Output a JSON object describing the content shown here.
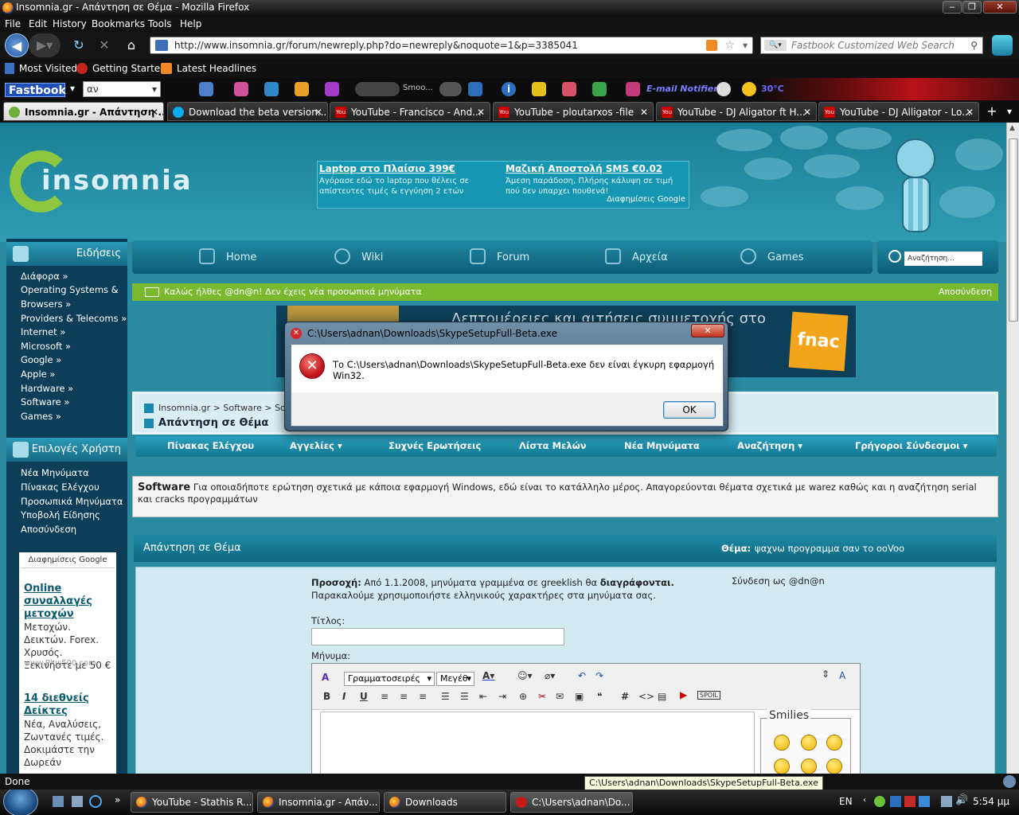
{
  "window": {
    "title": "Insomnia.gr - Απάντηση σε Θέμα - Mozilla Firefox"
  },
  "menu": [
    "File",
    "Edit",
    "History",
    "Bookmarks",
    "Tools",
    "Help"
  ],
  "nav": {
    "url": "http://www.insomnia.gr/forum/newreply.php?do=newreply&noquote=1&p=3385041",
    "search_placeholder": "Fastbook Customized Web Search"
  },
  "bookmarks": [
    "Most Visited",
    "Getting Started",
    "Latest Headlines"
  ],
  "toolbar": {
    "fastbook": "Fastbook",
    "select_value": "αν",
    "smooth": "Smoo...",
    "email": "E-mail Notifier",
    "temp": "30°C"
  },
  "tabs": [
    {
      "label": "Insomnia.gr - Απάντηση ..."
    },
    {
      "label": "Download the beta version..."
    },
    {
      "label": "YouTube - Francisco - And..."
    },
    {
      "label": "YouTube - ploutarxos -file"
    },
    {
      "label": "YouTube - DJ Aligator ft H..."
    },
    {
      "label": "YouTube - DJ Alligator - Lo..."
    }
  ],
  "site": {
    "logo": "insomnia",
    "ads": [
      {
        "title": "Laptop στο Πλαίσιο 399€",
        "text": "Αγόρασε εδώ το laptop που θέλεις σε απίστευτες τιμές & εγγύηση 2 ετών"
      },
      {
        "title": "Μαζική Αποστολή SMS €0.02",
        "text": "Άμεση παράδοση, Πλήρης κάλυψη σε τιμή πού δεν υπαρχει πουθενά!"
      }
    ],
    "ads_by": "Διαφημίσεις Google",
    "main_nav": [
      "Home",
      "Wiki",
      "Forum",
      "Αρχεία",
      "Games"
    ],
    "search_placeholder": "Αναζήτηση...",
    "welcome": "Καλώς ήλθες @dn@n! Δεν έχεις νέα προσωπικά μηνύματα",
    "logout": "Αποσύνδεση",
    "banner_text": "Λεπτομέρειες και αιτήσεις συμμετοχής στο",
    "banner_brand": "fnac"
  },
  "sidebar": {
    "news_head": "Ειδήσεις",
    "news": [
      "Διάφορα »",
      "Operating Systems &",
      "Browsers »",
      "Providers & Telecoms »",
      "Internet »",
      "Microsoft »",
      "Google »",
      "Apple »",
      "Hardware »",
      "Software »",
      "Games »"
    ],
    "user_head": "Επιλογές Χρήστη",
    "user": [
      "Νέα Μηνύματα",
      "Πίνακας Ελέγχου",
      "Προσωπικά Μηνύματα",
      "Υποβολή Είδησης",
      "Αποσύνδεση"
    ],
    "gads": {
      "head": "Διαφημίσεις Google",
      "ad1_title": "Online συναλλαγές μετοχών",
      "ad1_text": "Μετοχών. Δεικτών. Forex. Χρυσός. Ξεκινήστε με 50 €",
      "ad1_url": "www.Plus500.com",
      "ad2_title": "14 διεθνείς Δείκτες",
      "ad2_text": "Νέα, Αναλύσεις, Ζωντανές τιμές. Δοκιμάστε την Δωρεάν"
    }
  },
  "forum": {
    "breadcrumb": "Insomnia.gr  >  Software  >  Softw",
    "page_title": "Απάντηση σε Θέμα",
    "subnav": [
      "Πίνακας Ελέγχου",
      "Αγγελίες ▾",
      "Συχνές Ερωτήσεις",
      "Λίστα Μελών",
      "Νέα Μηνύματα",
      "Αναζήτηση ▾",
      "Γρήγοροι Σύνδεσμοι ▾"
    ],
    "desc_bold": "Software",
    "desc": "Για οποιαδήποτε ερώτηση σχετικά με κάποια εφαρμογή Windows, εδώ είναι το κατάλληλο μέρος. Απαγορεύονται θέματα σχετικά με warez καθώς και η αναζήτηση serial και cracks προγραμμάτων",
    "reply_head": "Απάντηση σε Θέμα",
    "topic_label": "Θέμα:",
    "topic": "ψαχνω προγραμμα σαν το ooVoo",
    "notice_bold": "Προσοχή:",
    "notice": "Από 1.1.2008, μηνύματα γραμμένα σε greeklish θα",
    "notice_bold2": "διαγράφονται.",
    "notice2": "Παρακαλούμε χρησιμοποιήστε ελληνικούς χαρακτήρες στα μηνύματα σας.",
    "logged_in": "Σύνδεση ως @dn@n",
    "title_label": "Τίτλος:",
    "message_label": "Μήνυμα:",
    "font_select": "Γραμματοσειρές",
    "size_select": "Μεγέθ",
    "smilies": "Smilies"
  },
  "dialog": {
    "title": "C:\\Users\\adnan\\Downloads\\SkypeSetupFull-Beta.exe",
    "message": "Το C:\\Users\\adnan\\Downloads\\SkypeSetupFull-Beta.exe δεν είναι έγκυρη εφαρμογή Win32.",
    "ok": "OK"
  },
  "status": {
    "text": "Done",
    "tooltip": "C:\\Users\\adnan\\Downloads\\SkypeSetupFull-Beta.exe"
  },
  "taskbar": {
    "items": [
      "YouTube - Stathis R...",
      "Insomnia.gr - Απάν...",
      "Downloads",
      "C:\\Users\\adnan\\Do..."
    ],
    "lang": "EN",
    "clock": "5:54 μμ"
  }
}
